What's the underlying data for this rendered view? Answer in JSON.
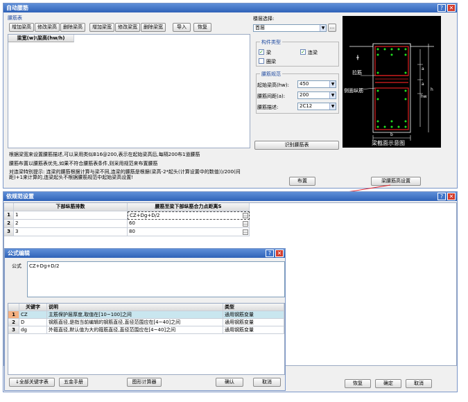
{
  "rebar_window": {
    "title": "自动腰筋",
    "help": "?",
    "close": "✕",
    "table_label": "腰筋表",
    "toolbar": [
      "增加梁高",
      "修改梁高",
      "删除梁高",
      "增加梁宽",
      "修改梁宽",
      "删除梁宽"
    ],
    "import_label": "导入",
    "restore_label": "恢复",
    "column_header": "梁宽(w)\\梁高(hw/h)",
    "floor_label": "楼层选择:",
    "floor_value": "首层",
    "member_group": "构件类型",
    "members": [
      {
        "label": "梁",
        "checked": true
      },
      {
        "label": "连梁",
        "checked": true
      },
      {
        "label": "圈梁",
        "checked": false
      }
    ],
    "rebar_group": "腰筋规范",
    "rebar_fields": [
      {
        "label": "起始梁高(hw):",
        "value": "450"
      },
      {
        "label": "腰筋间距(a):",
        "value": "200"
      },
      {
        "label": "腰筋描述:",
        "value": "2C12"
      }
    ],
    "identify_btn": "识别腰筋表",
    "diagram_caption": "梁截面示意图",
    "diagram_labels": {
      "tie": "拉筋",
      "side": "侧面纵筋",
      "a": "a",
      "hw": "hw",
      "h": "h",
      "b": "b"
    },
    "notes": [
      "根据梁宽来设置腰筋描述,可以采用类似B16@200,表示在起始梁高后,每隔200布1道腰筋",
      "腰筋布置以腰筋表优先,如果不符合腰筋表条件,则采用规范来布置腰筋",
      "对连梁特别提示: 连梁的腰筋根据计算与梁不同,连梁的腰筋是根据(梁高-2*起头(计算设置中的数值))/200(间距)+1来计算的,连梁起头不根据腰筋规范中起始梁高设置!"
    ],
    "layout_btn": "布置",
    "height_setting_btn": "梁腰筋高设置"
  },
  "spec_window": {
    "title": "依规范设置",
    "help": "?",
    "close": "✕",
    "headers": [
      "下部纵筋排数",
      "腰筋至梁下部纵筋合力点距离S"
    ],
    "rows": [
      {
        "num": "1",
        "rows_count": "1",
        "value": "CZ+Dg+D/2"
      },
      {
        "num": "2",
        "rows_count": "2",
        "value": "60"
      },
      {
        "num": "3",
        "rows_count": "3",
        "value": "80"
      }
    ],
    "restore_btn": "恢复",
    "ok_btn": "确定",
    "cancel_btn": "取消"
  },
  "formula_window": {
    "title": "公式编辑",
    "help": "?",
    "close": "✕",
    "formula_label": "公式",
    "formula_value": "CZ+Dg+D/2",
    "headers": [
      "关键字",
      "说明",
      "类型"
    ],
    "rows": [
      {
        "num": "1",
        "key": "CZ",
        "desc": "主筋保护层厚度,取值在[10~100]之间",
        "type": "通用钢筋变量"
      },
      {
        "num": "2",
        "key": "D",
        "desc": "钢筋直径,是指当前编辑的钢筋直径,直径范围应在[4~40]之间",
        "type": "通用钢筋变量"
      },
      {
        "num": "3",
        "key": "dg",
        "desc": "外箍直径,默认值为大的箍筋直径,直径范围应在[4~40]之间",
        "type": "通用钢筋变量"
      }
    ],
    "btn_all_keywords": "↓全部关键字表",
    "btn_manual": "五金手册",
    "btn_calculator": "图形计算器",
    "ok_btn": "确认",
    "cancel_btn": "取消"
  },
  "colors": {
    "title_bar": "#3a6cc4",
    "arrow": "#e0202a",
    "diagram_bg": "#000000",
    "stirrup": "#e02020",
    "bar": "#20e020"
  }
}
